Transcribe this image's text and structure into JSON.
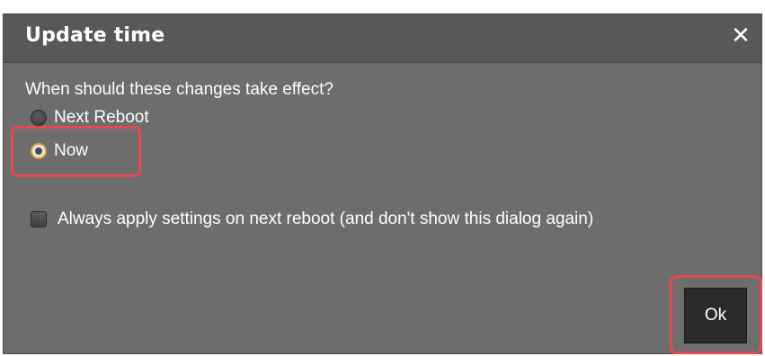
{
  "dialog": {
    "title": "Update time",
    "close_icon": "close-icon",
    "close_glyph": "✕",
    "question": "When should these changes take effect?",
    "options": [
      {
        "label": "Next Reboot",
        "selected": false
      },
      {
        "label": "Now",
        "selected": true
      }
    ],
    "checkbox": {
      "label": "Always apply settings on next reboot (and don't show this dialog again)",
      "checked": false
    },
    "ok_label": "Ok"
  },
  "colors": {
    "dialog_background": "#6d6d6d",
    "title_bar": "#585858",
    "ok_button": "#2b2b2b",
    "radio_selected_ring": "#e0a43a",
    "annotation_highlight": "#e5484d"
  }
}
